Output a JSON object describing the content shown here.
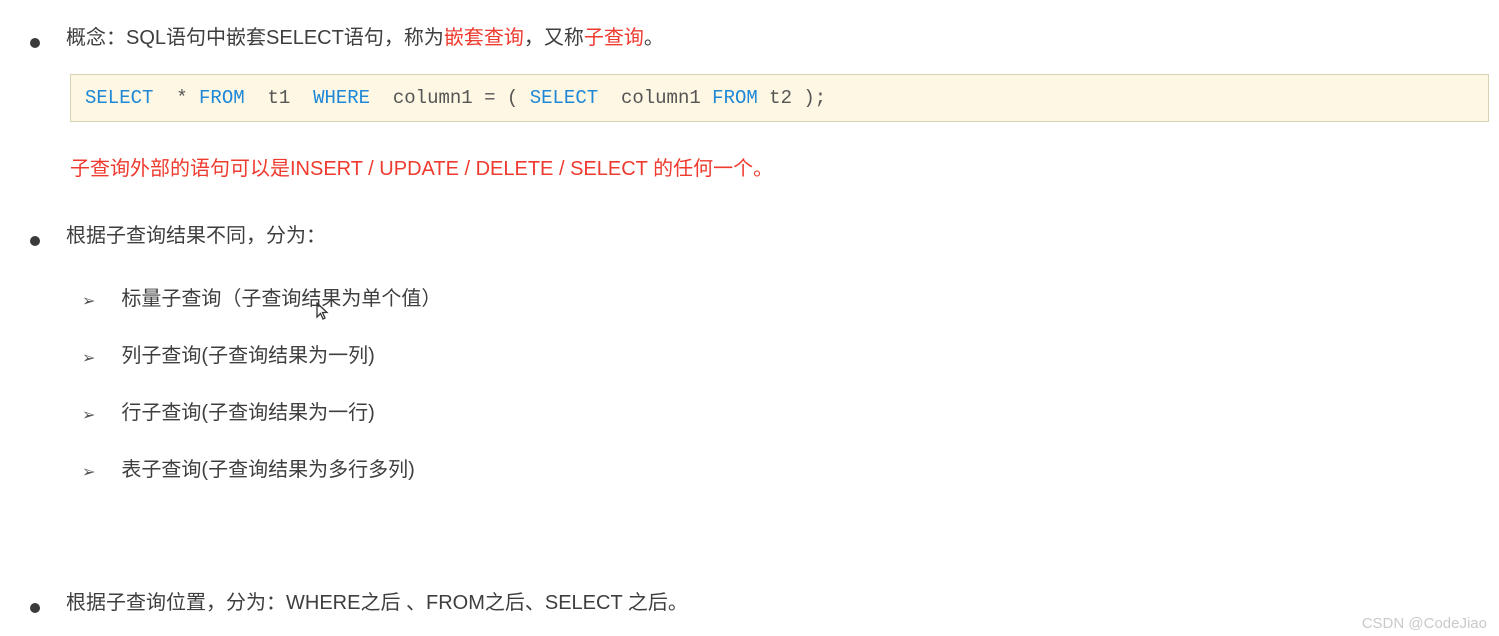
{
  "bullets": {
    "b1_prefix": "概念：SQL语句中嵌套SELECT语句，称为",
    "b1_hl1": "嵌套查询",
    "b1_mid": "，又称",
    "b1_hl2": "子查询",
    "b1_suffix": "。",
    "b2": "根据子查询结果不同，分为：",
    "b3": "根据子查询位置，分为：WHERE之后 、FROM之后、SELECT 之后。"
  },
  "code": {
    "kw_select1": "SELECT",
    "t_star": "  * ",
    "kw_from1": "FROM",
    "t_t1": "  t1  ",
    "kw_where": "WHERE",
    "t_col1": "  column1 = ( ",
    "kw_select2": "SELECT",
    "t_col2": "  column1 ",
    "kw_from2": "FROM",
    "t_t2": " t2 );"
  },
  "red_note": "子查询外部的语句可以是INSERT / UPDATE / DELETE / SELECT 的任何一个。",
  "sub_items": [
    "标量子查询（子查询结果为单个值）",
    "列子查询(子查询结果为一列)",
    "行子查询(子查询结果为一行)",
    "表子查询(子查询结果为多行多列)"
  ],
  "watermark": "CSDN @CodeJiao"
}
